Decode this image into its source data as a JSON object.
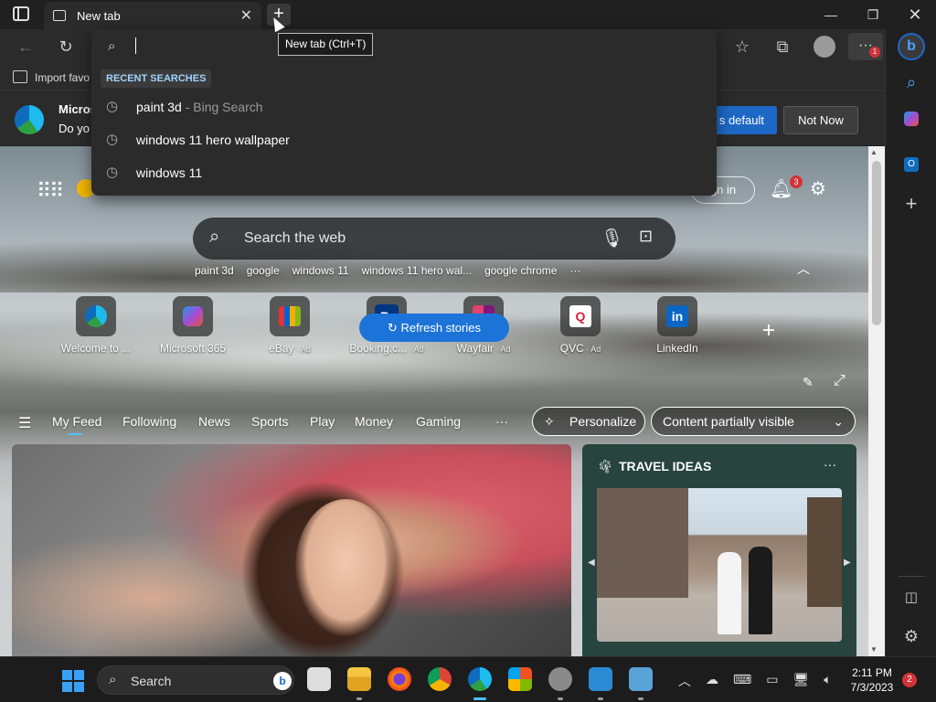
{
  "tab": {
    "title": "New tab"
  },
  "tooltip": "New tab (Ctrl+T)",
  "favbar": {
    "import_label": "Import favo"
  },
  "infobar": {
    "title_partial": "Micros",
    "body_partial": "Do yo",
    "set_default_label": "s default",
    "not_now_label": "Not Now"
  },
  "dropdown": {
    "recent_label": "RECENT SEARCHES",
    "items": [
      {
        "query": "paint 3d",
        "source": " - Bing Search"
      },
      {
        "query": "windows 11 hero wallpaper",
        "source": ""
      },
      {
        "query": "windows 11",
        "source": ""
      }
    ]
  },
  "header": {
    "signin_label": "gn in",
    "notif_count": "3"
  },
  "search": {
    "placeholder": "Search the web"
  },
  "trending": [
    "paint 3d",
    "google",
    "windows 11",
    "windows 11 hero wal...",
    "google chrome",
    "···"
  ],
  "quicklinks": [
    {
      "label": "Welcome to ...",
      "ad": ""
    },
    {
      "label": "Microsoft 365",
      "ad": ""
    },
    {
      "label": "eBay",
      "ad": " · Ad"
    },
    {
      "label": "Booking.c...",
      "ad": " · Ad"
    },
    {
      "label": "Wayfair",
      "ad": " · Ad"
    },
    {
      "label": "QVC",
      "ad": " · Ad"
    },
    {
      "label": "LinkedIn",
      "ad": ""
    }
  ],
  "feednav": {
    "items": [
      "My Feed",
      "Following",
      "News",
      "Sports",
      "Play",
      "Money",
      "Gaming",
      "···"
    ],
    "personalize_label": "Personalize",
    "content_select": "Content partially visible"
  },
  "refresh_label": "Refresh stories",
  "travel": {
    "title": "TRAVEL IDEAS",
    "more": "···"
  },
  "taskbar": {
    "search_label": "Search",
    "time": "2:11 PM",
    "date": "7/3/2023",
    "notif_count": "2"
  },
  "colors": {
    "accent": "#1d68c5",
    "badge": "#d13438",
    "travel_bg": "#27443f"
  }
}
